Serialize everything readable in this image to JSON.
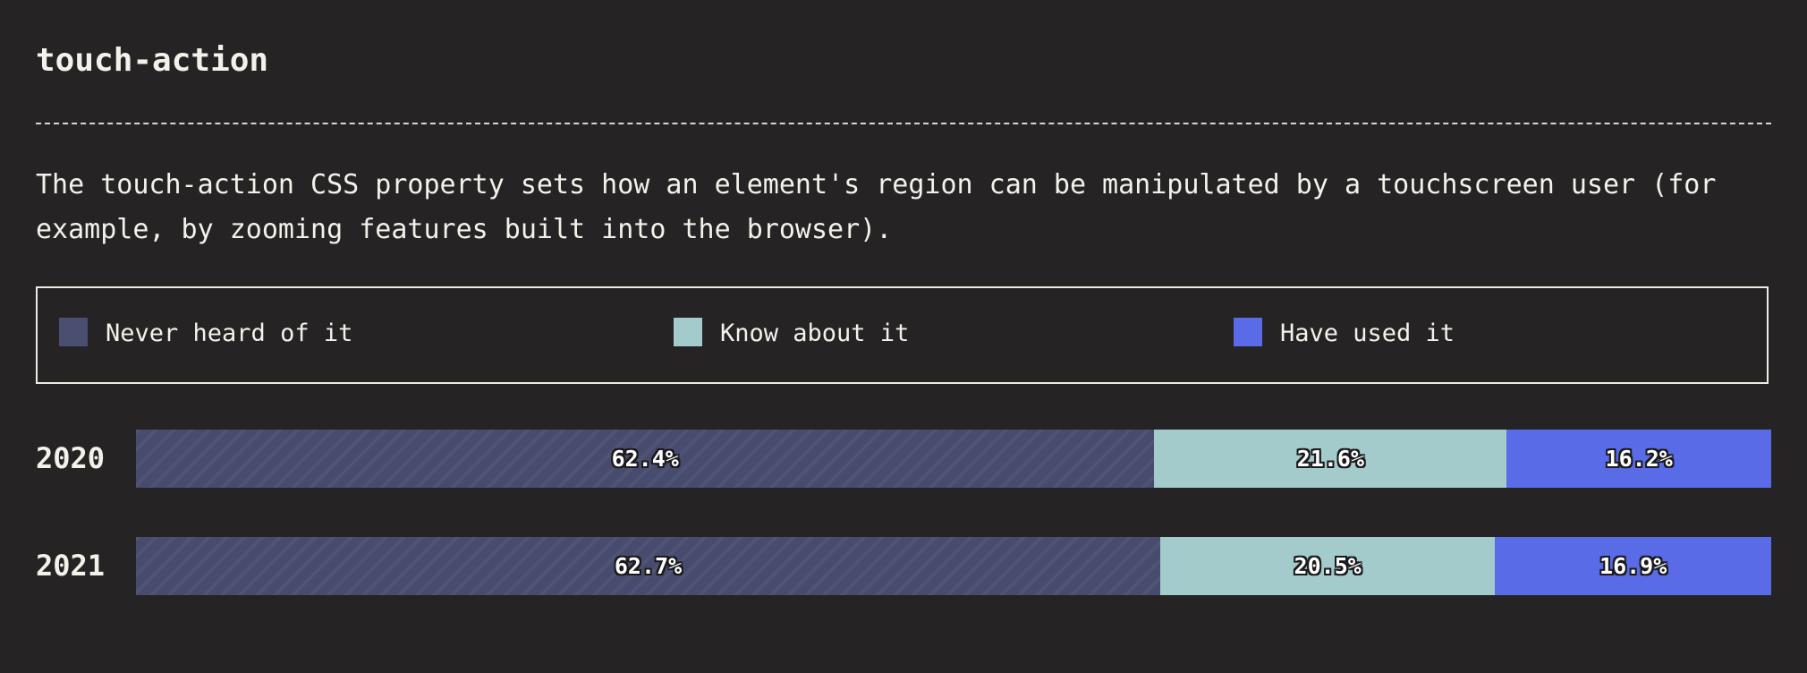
{
  "header": {
    "title": "touch-action",
    "description": "The touch-action CSS property sets how an element's region can be manipulated by a touchscreen user (for example, by zooming features built into the browser)."
  },
  "legend": {
    "items": [
      {
        "label": "Never heard of it",
        "color": "#4a4f72"
      },
      {
        "label": "Know about it",
        "color": "#a3cbcc"
      },
      {
        "label": "Have used it",
        "color": "#5a6be7"
      }
    ]
  },
  "chart_data": {
    "type": "bar",
    "orientation": "horizontal",
    "stacked": true,
    "normalized_to": 100,
    "title": "touch-action",
    "categories": [
      "2020",
      "2021"
    ],
    "series": [
      {
        "name": "Never heard of it",
        "values": [
          62.4,
          62.7
        ],
        "labels": [
          "62.4%",
          "62.7%"
        ],
        "color": "#474c6f"
      },
      {
        "name": "Know about it",
        "values": [
          21.6,
          20.5
        ],
        "labels": [
          "21.6%",
          "20.5%"
        ],
        "color": "#a3cbcc"
      },
      {
        "name": "Have used it",
        "values": [
          16.2,
          16.9
        ],
        "labels": [
          "16.2%",
          "16.9%"
        ],
        "color": "#5a6be7"
      }
    ],
    "legend_position": "top"
  }
}
